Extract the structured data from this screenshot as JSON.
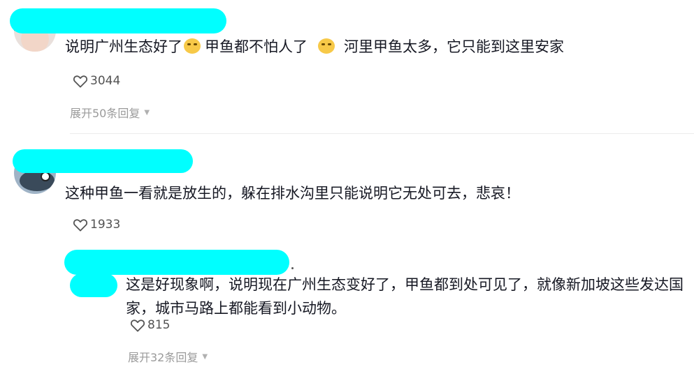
{
  "comments": [
    {
      "text_part1": "说明广州生态好了",
      "text_part2": "甲鱼都不怕人了",
      "text_part3": "河里甲鱼太多，它只能到这里安家",
      "likes": "3044",
      "expand_label": "展开50条回复"
    },
    {
      "text": "这种甲鱼一看就是放生的，躲在排水沟里只能说明它无处可去，悲哀！",
      "likes": "1933"
    }
  ],
  "reply": {
    "text": "这是好现象啊，说明现在广州生态变好了，甲鱼都到处可见了，就像新加坡这些发达国家，城市马路上都能看到小动物。",
    "likes": "815",
    "expand_label": "展开32条回复"
  },
  "icons": {
    "like": "heart-outline-icon",
    "emoji": "thinking-face-emoji",
    "expand": "caret-down-icon"
  },
  "colors": {
    "redaction": "#00ffff",
    "text": "#161823",
    "muted": "#9a9a9a"
  }
}
